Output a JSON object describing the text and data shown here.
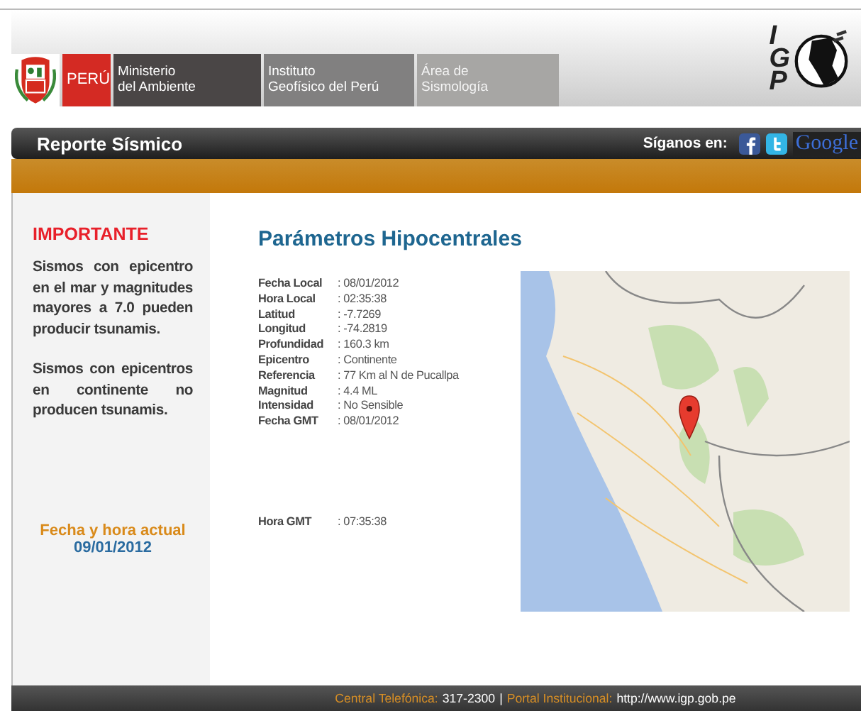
{
  "header": {
    "agencies": [
      {
        "kind": "country",
        "lines": [
          "PERÚ"
        ]
      },
      {
        "kind": "dark",
        "lines": [
          "Ministerio",
          "del Ambiente"
        ]
      },
      {
        "kind": "mid",
        "lines": [
          "Instituto",
          "Geofísico del Perú"
        ]
      },
      {
        "kind": "light",
        "lines": [
          "Área de",
          "Sismología"
        ]
      }
    ],
    "igp_letters": [
      "I",
      "G",
      "P"
    ]
  },
  "title_bar": {
    "title": "Reporte Sísmico",
    "follow_label": "Síganos en:",
    "google_label": "Google"
  },
  "sidebar": {
    "heading": "IMPORTANTE",
    "notes": [
      "Sismos con epicentro en el mar y magnitudes mayores a 7.0 pueden producir tsunamis.",
      "Sismos con epicentros en continente no producen tsunamis."
    ],
    "clock_label": "Fecha y hora actual",
    "clock_date": "09/01/2012"
  },
  "main": {
    "title": "Parámetros Hipocentrales",
    "parameters": [
      {
        "label": "Fecha Local",
        "value": ": 08/01/2012"
      },
      {
        "label": "Hora Local",
        "value": ": 02:35:38"
      },
      {
        "label": "Latitud",
        "value": ": -7.7269"
      },
      {
        "label": "Longitud",
        "value": ": -74.2819"
      },
      {
        "label": "Profundidad",
        "value": ": 160.3 km"
      },
      {
        "label": "Epicentro",
        "value": ": Continente"
      },
      {
        "label": "Referencia",
        "value": ": 77 Km al N de Pucallpa"
      },
      {
        "label": "Magnitud",
        "value": ": 4.4 ML"
      },
      {
        "label": "Intensidad",
        "value": ": No Sensible"
      },
      {
        "label": "Fecha GMT",
        "value": ": 08/01/2012"
      }
    ],
    "extra_parameters": [
      {
        "label": "Hora GMT",
        "value": ": 07:35:38"
      }
    ]
  },
  "footer": [
    {
      "label": "Central Telefónica:",
      "value": "317-2300"
    },
    {
      "separator": "|",
      "label": "Portal Institucional:",
      "value": "http://www.igp.gob.pe"
    }
  ]
}
